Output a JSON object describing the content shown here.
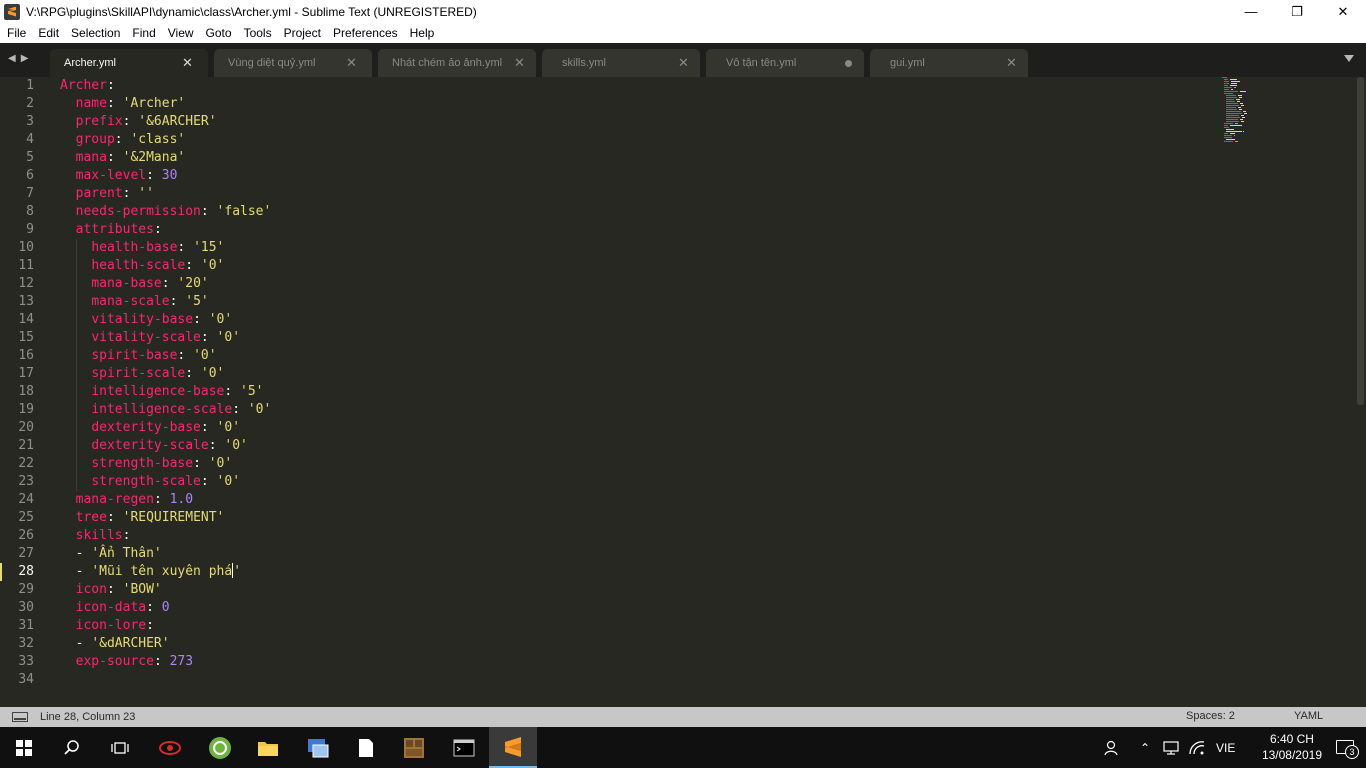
{
  "window": {
    "title": "V:\\RPG\\plugins\\SkillAPI\\dynamic\\class\\Archer.yml - Sublime Text (UNREGISTERED)",
    "minimize": "—",
    "maximize": "❐",
    "close": "✕"
  },
  "menu": [
    "File",
    "Edit",
    "Selection",
    "Find",
    "View",
    "Goto",
    "Tools",
    "Project",
    "Preferences",
    "Help"
  ],
  "tabs": [
    {
      "label": "Archer.yml",
      "active": true,
      "dirty": false
    },
    {
      "label": "Vùng diệt quỷ.yml",
      "active": false,
      "dirty": false
    },
    {
      "label": "Nhát chém ảo ảnh.yml",
      "active": false,
      "dirty": false
    },
    {
      "label": "skills.yml",
      "active": false,
      "dirty": false
    },
    {
      "label": "Vô tận tên.yml",
      "active": false,
      "dirty": true
    },
    {
      "label": "gui.yml",
      "active": false,
      "dirty": false
    }
  ],
  "editor": {
    "current_line": 28,
    "line_numbers": [
      "1",
      "2",
      "3",
      "4",
      "5",
      "6",
      "7",
      "8",
      "9",
      "10",
      "11",
      "12",
      "13",
      "14",
      "15",
      "16",
      "17",
      "18",
      "19",
      "20",
      "21",
      "22",
      "23",
      "24",
      "25",
      "26",
      "27",
      "28",
      "29",
      "30",
      "31",
      "32",
      "33",
      "34"
    ],
    "lines": [
      [
        [
          "k",
          "Archer"
        ],
        [
          "p",
          ":"
        ]
      ],
      [
        [
          "p",
          "  "
        ],
        [
          "k",
          "name"
        ],
        [
          "p",
          ": "
        ],
        [
          "s",
          "'Archer'"
        ]
      ],
      [
        [
          "p",
          "  "
        ],
        [
          "k",
          "prefix"
        ],
        [
          "p",
          ": "
        ],
        [
          "s",
          "'&6ARCHER'"
        ]
      ],
      [
        [
          "p",
          "  "
        ],
        [
          "k",
          "group"
        ],
        [
          "p",
          ": "
        ],
        [
          "s",
          "'class'"
        ]
      ],
      [
        [
          "p",
          "  "
        ],
        [
          "k",
          "mana"
        ],
        [
          "p",
          ": "
        ],
        [
          "s",
          "'&2Mana'"
        ]
      ],
      [
        [
          "p",
          "  "
        ],
        [
          "k",
          "max-level"
        ],
        [
          "p",
          ": "
        ],
        [
          "n",
          "30"
        ]
      ],
      [
        [
          "p",
          "  "
        ],
        [
          "k",
          "parent"
        ],
        [
          "p",
          ": "
        ],
        [
          "s",
          "''"
        ]
      ],
      [
        [
          "p",
          "  "
        ],
        [
          "k",
          "needs-permission"
        ],
        [
          "p",
          ": "
        ],
        [
          "s",
          "'false'"
        ]
      ],
      [
        [
          "p",
          "  "
        ],
        [
          "k",
          "attributes"
        ],
        [
          "p",
          ":"
        ]
      ],
      [
        [
          "p",
          "    "
        ],
        [
          "k",
          "health-base"
        ],
        [
          "p",
          ": "
        ],
        [
          "s",
          "'15'"
        ]
      ],
      [
        [
          "p",
          "    "
        ],
        [
          "k",
          "health-scale"
        ],
        [
          "p",
          ": "
        ],
        [
          "s",
          "'0'"
        ]
      ],
      [
        [
          "p",
          "    "
        ],
        [
          "k",
          "mana-base"
        ],
        [
          "p",
          ": "
        ],
        [
          "s",
          "'20'"
        ]
      ],
      [
        [
          "p",
          "    "
        ],
        [
          "k",
          "mana-scale"
        ],
        [
          "p",
          ": "
        ],
        [
          "s",
          "'5'"
        ]
      ],
      [
        [
          "p",
          "    "
        ],
        [
          "k",
          "vitality-base"
        ],
        [
          "p",
          ": "
        ],
        [
          "s",
          "'0'"
        ]
      ],
      [
        [
          "p",
          "    "
        ],
        [
          "k",
          "vitality-scale"
        ],
        [
          "p",
          ": "
        ],
        [
          "s",
          "'0'"
        ]
      ],
      [
        [
          "p",
          "    "
        ],
        [
          "k",
          "spirit-base"
        ],
        [
          "p",
          ": "
        ],
        [
          "s",
          "'0'"
        ]
      ],
      [
        [
          "p",
          "    "
        ],
        [
          "k",
          "spirit-scale"
        ],
        [
          "p",
          ": "
        ],
        [
          "s",
          "'0'"
        ]
      ],
      [
        [
          "p",
          "    "
        ],
        [
          "k",
          "intelligence-base"
        ],
        [
          "p",
          ": "
        ],
        [
          "s",
          "'5'"
        ]
      ],
      [
        [
          "p",
          "    "
        ],
        [
          "k",
          "intelligence-scale"
        ],
        [
          "p",
          ": "
        ],
        [
          "s",
          "'0'"
        ]
      ],
      [
        [
          "p",
          "    "
        ],
        [
          "k",
          "dexterity-base"
        ],
        [
          "p",
          ": "
        ],
        [
          "s",
          "'0'"
        ]
      ],
      [
        [
          "p",
          "    "
        ],
        [
          "k",
          "dexterity-scale"
        ],
        [
          "p",
          ": "
        ],
        [
          "s",
          "'0'"
        ]
      ],
      [
        [
          "p",
          "    "
        ],
        [
          "k",
          "strength-base"
        ],
        [
          "p",
          ": "
        ],
        [
          "s",
          "'0'"
        ]
      ],
      [
        [
          "p",
          "    "
        ],
        [
          "k",
          "strength-scale"
        ],
        [
          "p",
          ": "
        ],
        [
          "s",
          "'0'"
        ]
      ],
      [
        [
          "p",
          "  "
        ],
        [
          "k",
          "mana-regen"
        ],
        [
          "p",
          ": "
        ],
        [
          "n",
          "1.0"
        ]
      ],
      [
        [
          "p",
          "  "
        ],
        [
          "k",
          "tree"
        ],
        [
          "p",
          ": "
        ],
        [
          "s",
          "'REQUIREMENT'"
        ]
      ],
      [
        [
          "p",
          "  "
        ],
        [
          "k",
          "skills"
        ],
        [
          "p",
          ":"
        ]
      ],
      [
        [
          "p",
          "  - "
        ],
        [
          "s",
          "'Ẩn Thân'"
        ]
      ],
      [
        [
          "p",
          "  - "
        ],
        [
          "s",
          "'Mũi tên xuyên phá"
        ],
        [
          "c",
          ""
        ],
        [
          "s",
          "'"
        ]
      ],
      [
        [
          "p",
          "  "
        ],
        [
          "k",
          "icon"
        ],
        [
          "p",
          ": "
        ],
        [
          "s",
          "'BOW'"
        ]
      ],
      [
        [
          "p",
          "  "
        ],
        [
          "k",
          "icon-data"
        ],
        [
          "p",
          ": "
        ],
        [
          "n",
          "0"
        ]
      ],
      [
        [
          "p",
          "  "
        ],
        [
          "k",
          "icon-lore"
        ],
        [
          "p",
          ":"
        ]
      ],
      [
        [
          "p",
          "  - "
        ],
        [
          "s",
          "'&dARCHER'"
        ]
      ],
      [
        [
          "p",
          "  "
        ],
        [
          "k",
          "exp-source"
        ],
        [
          "p",
          ": "
        ],
        [
          "n",
          "273"
        ]
      ],
      []
    ]
  },
  "status": {
    "position": "Line 28, Column 23",
    "spaces": "Spaces: 2",
    "syntax": "YAML"
  },
  "taskbar": {
    "language": "VIE",
    "time": "6:40 CH",
    "date": "13/08/2019",
    "notification_count": "3"
  },
  "colors": {
    "keyword": "#f92672",
    "string": "#e6db74",
    "number": "#ae81ff",
    "background": "#272822"
  }
}
